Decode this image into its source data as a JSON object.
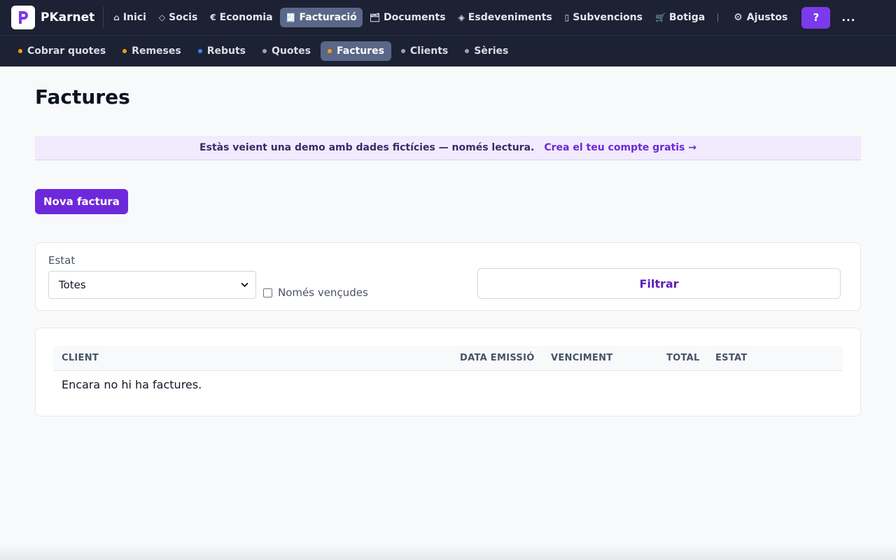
{
  "app": {
    "name": "PKarnet"
  },
  "nav": {
    "items": [
      {
        "label": "Inici",
        "icon": "home-icon",
        "glyph": "⌂",
        "active": false
      },
      {
        "label": "Socis",
        "icon": "diamond-icon",
        "glyph": "◇",
        "active": false
      },
      {
        "label": "Economia",
        "icon": "euro-icon",
        "glyph": "€",
        "active": false
      },
      {
        "label": "Facturació",
        "icon": "receipt-icon",
        "glyph": "🧾",
        "active": true
      },
      {
        "label": "Documents",
        "icon": "folder-icon",
        "glyph": "🗂",
        "active": false
      },
      {
        "label": "Esdeveniments",
        "icon": "event-diamond-icon",
        "glyph": "◈",
        "active": false
      },
      {
        "label": "Subvencions",
        "icon": "book-icon",
        "glyph": "▯",
        "active": false
      },
      {
        "label": "Botiga",
        "icon": "cart-icon",
        "glyph": "🛒",
        "active": false
      }
    ],
    "settings_label": "Ajustos",
    "settings_glyph": "⚙",
    "help_label": "?",
    "more_label": "..."
  },
  "subnav": {
    "items": [
      {
        "label": "Cobrar quotes",
        "dot_color": "#f59e0b",
        "active": false
      },
      {
        "label": "Remeses",
        "dot_color": "#f59e0b",
        "active": false
      },
      {
        "label": "Rebuts",
        "dot_color": "#3b82f6",
        "active": false
      },
      {
        "label": "Quotes",
        "dot_color": "#9ca3af",
        "active": false
      },
      {
        "label": "Factures",
        "dot_color": "#f59e0b",
        "active": true
      },
      {
        "label": "Clients",
        "dot_color": "#9ca3af",
        "active": false
      },
      {
        "label": "Sèries",
        "dot_color": "#9ca3af",
        "active": false
      }
    ]
  },
  "page": {
    "title": "Factures",
    "demo_banner": {
      "text": "Estàs veient una demo amb dades fictícies — només lectura.",
      "link": "Crea el teu compte gratis →"
    },
    "new_button": "Nova factura",
    "filter": {
      "status_label": "Estat",
      "status_value": "Totes",
      "overdue_label": "Només vençudes",
      "overdue_checked": false,
      "submit_label": "Filtrar"
    },
    "table": {
      "columns": [
        "CLIENT",
        "DATA EMISSIÓ",
        "VENCIMENT",
        "TOTAL",
        "ESTAT"
      ],
      "empty_message": "Encara no hi ha factures."
    }
  },
  "colors": {
    "nav_bg": "#1c2233",
    "accent": "#6d28d9",
    "help_button": "#7c3aed",
    "banner_bg": "#f1ebfd"
  }
}
